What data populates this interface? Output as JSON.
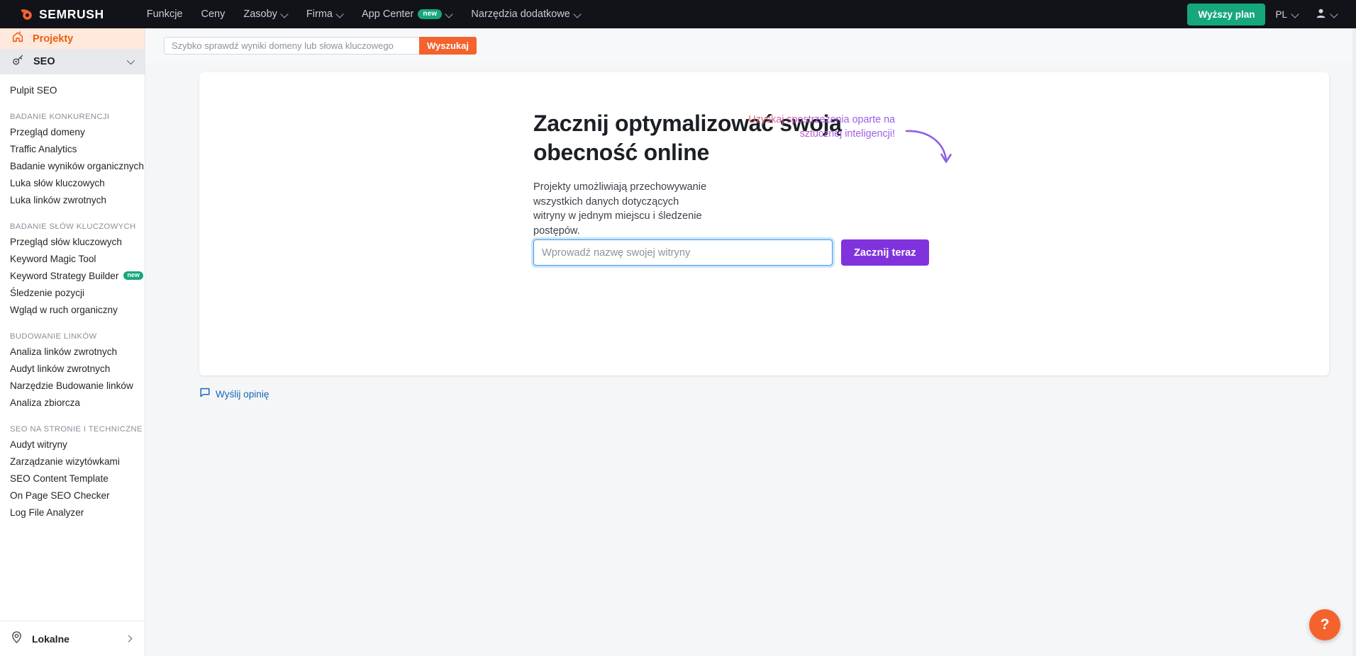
{
  "topnav": {
    "logo_text": "SEMRUSH",
    "logo_icon": "semrush-flame-icon",
    "items": [
      {
        "label": "Funkcje",
        "caret": false
      },
      {
        "label": "Ceny",
        "caret": false
      },
      {
        "label": "Zasoby",
        "caret": true
      },
      {
        "label": "Firma",
        "caret": true
      },
      {
        "label": "App Center",
        "caret": true,
        "badge": "new"
      },
      {
        "label": "Narzędzia dodatkowe",
        "caret": true
      }
    ],
    "upgrade_label": "Wyższy plan",
    "language": "PL",
    "account_icon": "user-avatar-icon"
  },
  "search": {
    "placeholder": "Szybko sprawdź wyniki domeny lub słowa kluczowego",
    "value": "",
    "button_label": "Wyszukaj"
  },
  "sidebar": {
    "projects_label": "Projekty",
    "projects_icon": "home-icon",
    "seo_label": "SEO",
    "seo_icon": "key-icon",
    "dashboard_label": "Pulpit SEO",
    "groups": [
      {
        "title": "BADANIE KONKURENCJI",
        "items": [
          {
            "label": "Przegląd domeny"
          },
          {
            "label": "Traffic Analytics"
          },
          {
            "label": "Badanie wyników organicznych"
          },
          {
            "label": "Luka słów kluczowych"
          },
          {
            "label": "Luka linków zwrotnych"
          }
        ]
      },
      {
        "title": "BADANIE SŁÓW KLUCZOWYCH",
        "items": [
          {
            "label": "Przegląd słów kluczowych"
          },
          {
            "label": "Keyword Magic Tool"
          },
          {
            "label": "Keyword Strategy Builder",
            "badge": "new"
          },
          {
            "label": "Śledzenie pozycji"
          },
          {
            "label": "Wgląd w ruch organiczny"
          }
        ]
      },
      {
        "title": "BUDOWANIE LINKÓW",
        "items": [
          {
            "label": "Analiza linków zwrotnych"
          },
          {
            "label": "Audyt linków zwrotnych"
          },
          {
            "label": "Narzędzie Budowanie linków"
          },
          {
            "label": "Analiza zbiorcza"
          }
        ]
      },
      {
        "title": "SEO NA STRONIE I TECHNICZNE",
        "items": [
          {
            "label": "Audyt witryny"
          },
          {
            "label": "Zarządzanie wizytówkami"
          },
          {
            "label": "SEO Content Template"
          },
          {
            "label": "On Page SEO Checker"
          },
          {
            "label": "Log File Analyzer"
          }
        ]
      }
    ],
    "bottom_label": "Lokalne",
    "bottom_icon": "location-pin-icon"
  },
  "hero": {
    "title": "Zacznij optymalizować swoją obecność online",
    "body": "Projekty umożliwiają przechowywanie wszystkich danych dotyczących witryny w jednym miejscu i śledzenie postępów.",
    "ai_note": "Uzyskaj spostrzeżenia oparte na sztucznej inteligencji!",
    "input_placeholder": "Wprowadź nazwę swojej witryny",
    "input_value": "",
    "start_label": "Zacznij teraz"
  },
  "feedback": {
    "label": "Wyślij opinię",
    "icon": "speech-bubble-icon"
  },
  "help": {
    "label": "?",
    "icon": "question-mark-icon"
  },
  "colors": {
    "brand_orange": "#f4622e",
    "upgrade_green": "#16a77c",
    "badge_green": "#19a67b",
    "cta_purple": "#8033dd",
    "focus_blue": "#3b9df0",
    "link_blue": "#1667b8",
    "topnav_dark": "#111319"
  }
}
